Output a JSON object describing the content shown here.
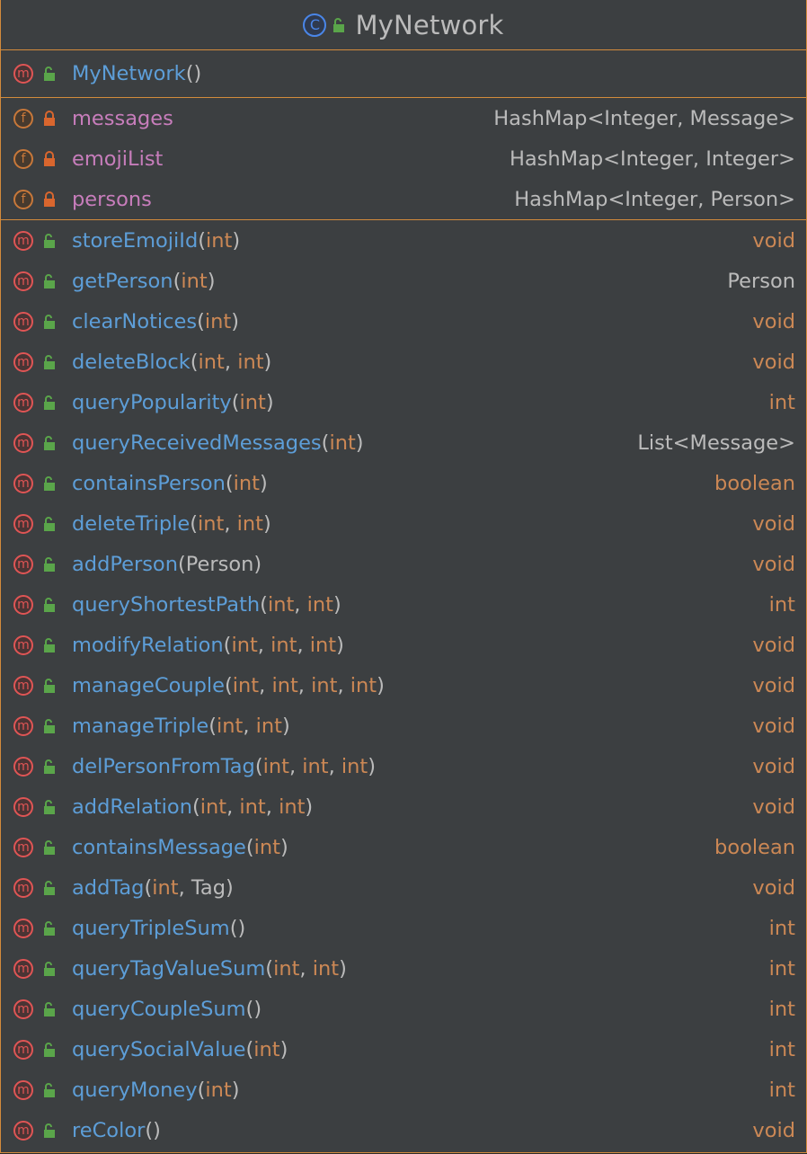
{
  "class": {
    "title": "MyNetwork",
    "kind_icon": "class-icon",
    "kind_letter": "C"
  },
  "constructor": {
    "name": "MyNetwork",
    "params": [],
    "visibility": "public"
  },
  "fields": [
    {
      "name": "messages",
      "type": "HashMap<Integer, Message>",
      "visibility": "private"
    },
    {
      "name": "emojiList",
      "type": "HashMap<Integer, Integer>",
      "visibility": "private"
    },
    {
      "name": "persons",
      "type": "HashMap<Integer, Person>",
      "visibility": "private"
    }
  ],
  "methods": [
    {
      "name": "storeEmojiId",
      "params": [
        "int"
      ],
      "ret": "void",
      "ret_kind": "prim"
    },
    {
      "name": "getPerson",
      "params": [
        "int"
      ],
      "ret": "Person",
      "ret_kind": "class"
    },
    {
      "name": "clearNotices",
      "params": [
        "int"
      ],
      "ret": "void",
      "ret_kind": "prim"
    },
    {
      "name": "deleteBlock",
      "params": [
        "int",
        "int"
      ],
      "ret": "void",
      "ret_kind": "prim"
    },
    {
      "name": "queryPopularity",
      "params": [
        "int"
      ],
      "ret": "int",
      "ret_kind": "prim"
    },
    {
      "name": "queryReceivedMessages",
      "params": [
        "int"
      ],
      "ret": "List<Message>",
      "ret_kind": "class"
    },
    {
      "name": "containsPerson",
      "params": [
        "int"
      ],
      "ret": "boolean",
      "ret_kind": "prim"
    },
    {
      "name": "deleteTriple",
      "params": [
        "int",
        "int"
      ],
      "ret": "void",
      "ret_kind": "prim"
    },
    {
      "name": "addPerson",
      "params": [
        "Person"
      ],
      "ret": "void",
      "ret_kind": "prim"
    },
    {
      "name": "queryShortestPath",
      "params": [
        "int",
        "int"
      ],
      "ret": "int",
      "ret_kind": "prim"
    },
    {
      "name": "modifyRelation",
      "params": [
        "int",
        "int",
        "int"
      ],
      "ret": "void",
      "ret_kind": "prim"
    },
    {
      "name": "manageCouple",
      "params": [
        "int",
        "int",
        "int",
        "int"
      ],
      "ret": "void",
      "ret_kind": "prim"
    },
    {
      "name": "manageTriple",
      "params": [
        "int",
        "int"
      ],
      "ret": "void",
      "ret_kind": "prim"
    },
    {
      "name": "delPersonFromTag",
      "params": [
        "int",
        "int",
        "int"
      ],
      "ret": "void",
      "ret_kind": "prim"
    },
    {
      "name": "addRelation",
      "params": [
        "int",
        "int",
        "int"
      ],
      "ret": "void",
      "ret_kind": "prim"
    },
    {
      "name": "containsMessage",
      "params": [
        "int"
      ],
      "ret": "boolean",
      "ret_kind": "prim"
    },
    {
      "name": "addTag",
      "params": [
        "int",
        "Tag"
      ],
      "ret": "void",
      "ret_kind": "prim"
    },
    {
      "name": "queryTripleSum",
      "params": [],
      "ret": "int",
      "ret_kind": "prim"
    },
    {
      "name": "queryTagValueSum",
      "params": [
        "int",
        "int"
      ],
      "ret": "int",
      "ret_kind": "prim"
    },
    {
      "name": "queryCoupleSum",
      "params": [],
      "ret": "int",
      "ret_kind": "prim"
    },
    {
      "name": "querySocialValue",
      "params": [
        "int"
      ],
      "ret": "int",
      "ret_kind": "prim"
    },
    {
      "name": "queryMoney",
      "params": [
        "int"
      ],
      "ret": "int",
      "ret_kind": "prim"
    },
    {
      "name": "reColor",
      "params": [],
      "ret": "void",
      "ret_kind": "prim"
    }
  ],
  "badges": {
    "method": "m",
    "field": "f"
  },
  "colors": {
    "border": "#d38b3c",
    "background": "#3c3f41",
    "method_name": "#5d9ed8",
    "field_name": "#c77dbb",
    "primitive": "#cc8855",
    "class_type": "#bbbbbb",
    "public_lock": "#5aa54a",
    "private_lock": "#d9662e"
  }
}
